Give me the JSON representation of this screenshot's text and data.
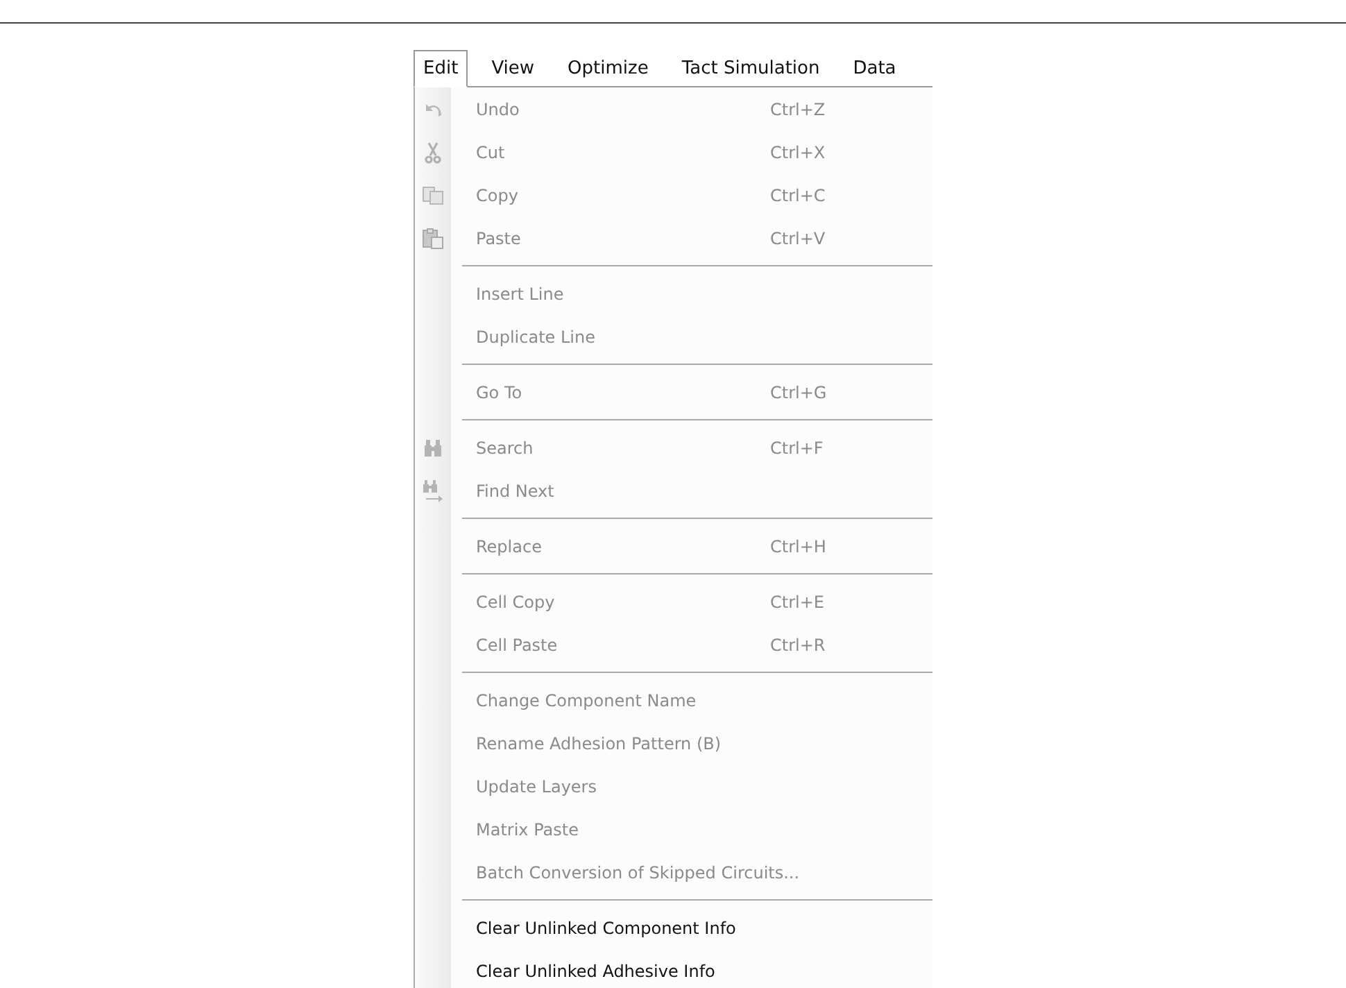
{
  "menubar": [
    {
      "label": "Edit",
      "selected": true
    },
    {
      "label": "View",
      "selected": false
    },
    {
      "label": "Optimize",
      "selected": false
    },
    {
      "label": "Tact Simulation",
      "selected": false
    },
    {
      "label": "Data",
      "selected": false
    }
  ],
  "menu": [
    {
      "kind": "undo",
      "label": "Undo",
      "shortcut": "Ctrl+Z",
      "disabled": true
    },
    {
      "kind": "cut",
      "label": "Cut",
      "shortcut": "Ctrl+X",
      "disabled": true
    },
    {
      "kind": "copy",
      "label": "Copy",
      "shortcut": "Ctrl+C",
      "disabled": true
    },
    {
      "kind": "paste",
      "label": "Paste",
      "shortcut": "Ctrl+V",
      "disabled": true
    },
    {
      "kind": "separator"
    },
    {
      "kind": "item",
      "label": "Insert Line",
      "disabled": true
    },
    {
      "kind": "item",
      "label": "Duplicate Line",
      "disabled": true
    },
    {
      "kind": "separator"
    },
    {
      "kind": "item",
      "label": "Go To",
      "shortcut": "Ctrl+G",
      "disabled": true
    },
    {
      "kind": "separator"
    },
    {
      "kind": "search",
      "label": "Search",
      "shortcut": "Ctrl+F",
      "disabled": true
    },
    {
      "kind": "findnext",
      "label": "Find Next",
      "disabled": true
    },
    {
      "kind": "separator"
    },
    {
      "kind": "item",
      "label": "Replace",
      "shortcut": "Ctrl+H",
      "disabled": true
    },
    {
      "kind": "separator"
    },
    {
      "kind": "item",
      "label": "Cell Copy",
      "shortcut": "Ctrl+E",
      "disabled": true
    },
    {
      "kind": "item",
      "label": "Cell Paste",
      "shortcut": "Ctrl+R",
      "disabled": true
    },
    {
      "kind": "separator"
    },
    {
      "kind": "item",
      "label": "Change Component Name",
      "disabled": true
    },
    {
      "kind": "item",
      "label": "Rename Adhesion Pattern (B)",
      "disabled": true
    },
    {
      "kind": "item",
      "label": "Update Layers",
      "disabled": true
    },
    {
      "kind": "item",
      "label": "Matrix Paste",
      "disabled": true
    },
    {
      "kind": "item",
      "label": "Batch Conversion of Skipped Circuits...",
      "disabled": true
    },
    {
      "kind": "separator"
    },
    {
      "kind": "item",
      "label": "Clear Unlinked Component Info",
      "disabled": false
    },
    {
      "kind": "item",
      "label": "Clear Unlinked Adhesive Info",
      "disabled": false
    }
  ]
}
